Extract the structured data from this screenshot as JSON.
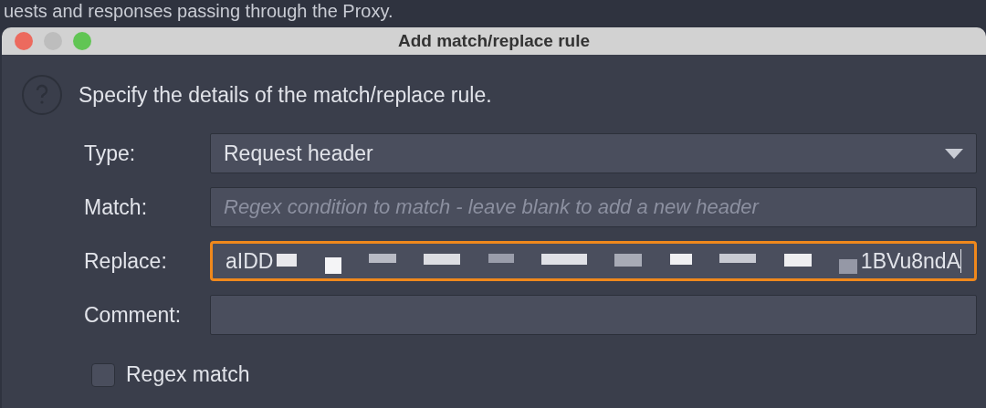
{
  "background_text": "uests and responses passing through the Proxy.",
  "window": {
    "title": "Add match/replace rule"
  },
  "intro": "Specify the details of the match/replace rule.",
  "fields": [
    {
      "kind": "select",
      "label": "Type:",
      "value": "Request header",
      "focused": false
    },
    {
      "kind": "text",
      "label": "Match:",
      "placeholder": "Regex condition to match - leave blank to add a new header",
      "focused": false
    },
    {
      "kind": "masked",
      "label": "Replace:",
      "value_start": "aIDD",
      "value_end": "1BVu8ndA",
      "focused": true
    },
    {
      "kind": "text",
      "label": "Comment:",
      "focused": false
    }
  ],
  "options": [
    {
      "label": "Regex match",
      "checked": false
    }
  ]
}
